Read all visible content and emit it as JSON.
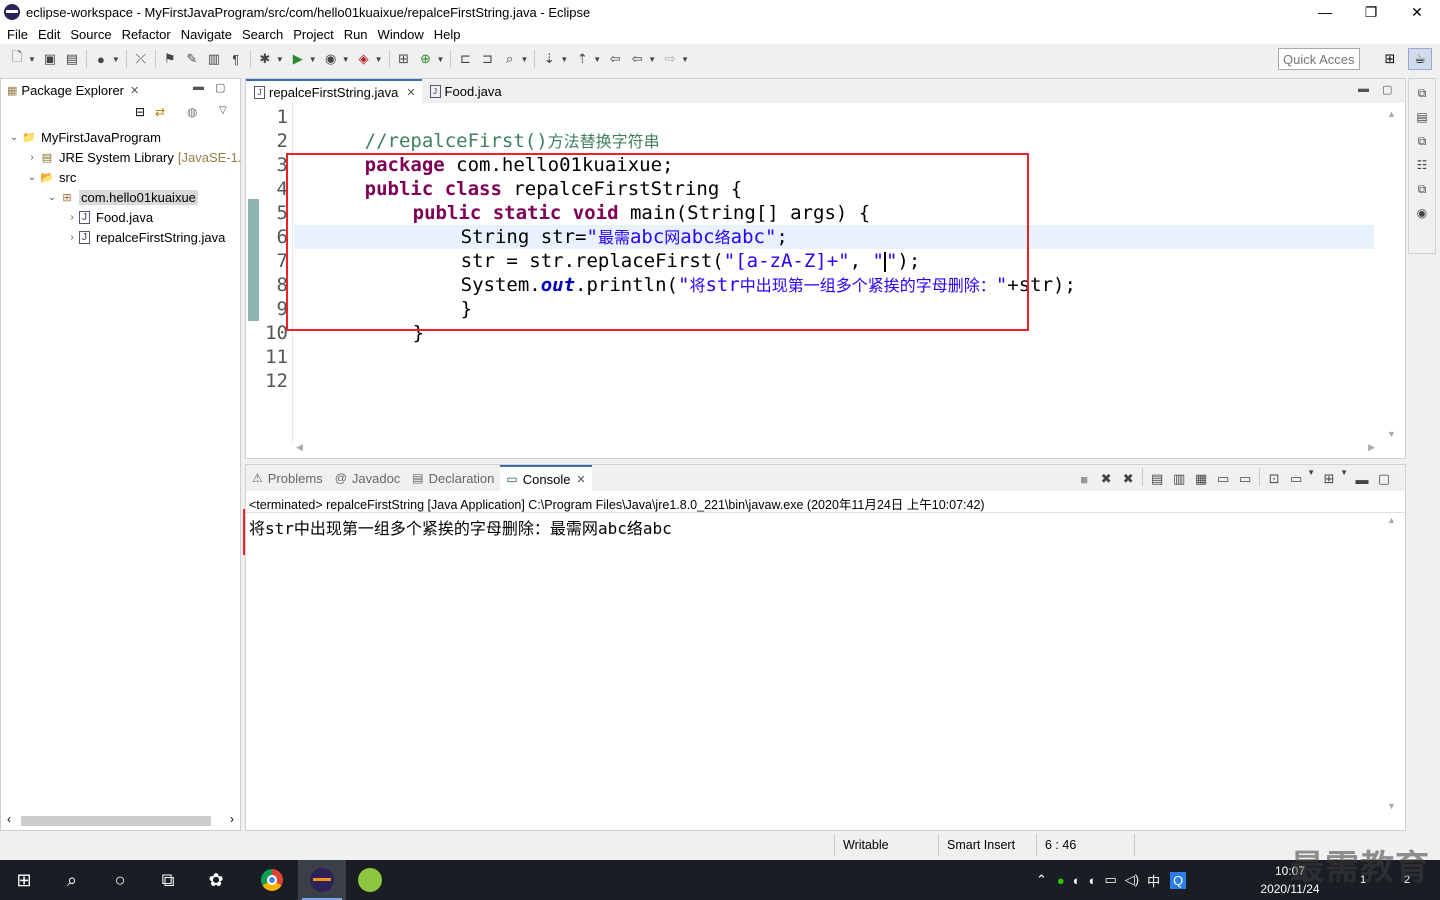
{
  "window": {
    "title": "eclipse-workspace - MyFirstJavaProgram/src/com/hello01kuaixue/repalceFirstString.java - Eclipse",
    "minimize": "—",
    "maximize": "❐",
    "close": "✕"
  },
  "menu": [
    "File",
    "Edit",
    "Source",
    "Refactor",
    "Navigate",
    "Search",
    "Project",
    "Run",
    "Window",
    "Help"
  ],
  "toolbar": {
    "quick_access_placeholder": "Quick Access"
  },
  "package_explorer": {
    "title": "Package Explorer",
    "tree": [
      {
        "label": "MyFirstJavaProgram",
        "decoration": "",
        "icon": "project-icon"
      },
      {
        "label": "JRE System Library",
        "decoration": "[JavaSE-1.",
        "icon": "library-icon"
      },
      {
        "label": "src",
        "decoration": "",
        "icon": "source-folder-icon"
      },
      {
        "label": "com.hello01kuaixue",
        "decoration": "",
        "icon": "package-icon"
      },
      {
        "label": "Food.java",
        "decoration": "",
        "icon": "java-file-icon"
      },
      {
        "label": "repalceFirstString.java",
        "decoration": "",
        "icon": "java-file-icon"
      }
    ]
  },
  "editor": {
    "tabs": [
      {
        "label": "repalceFirstString.java",
        "active": true
      },
      {
        "label": "Food.java",
        "active": false
      }
    ],
    "line_numbers": [
      "1",
      "2",
      "3",
      "4",
      "5",
      "6",
      "7",
      "8",
      "9",
      "10",
      "11",
      "12"
    ],
    "code": {
      "l1_comment": "//repalceFirst()",
      "l1_comment_cjk": "方法替换字符串",
      "l2_kw": "package",
      "l2_rest": " com.hello01kuaixue;",
      "l3_kw": "public class",
      "l3_rest": " repalceFirstString {",
      "l4_kw": "public static void",
      "l4_rest": " main(String[] args) {",
      "l5_pre": "String str=",
      "l5_str_q": "\"",
      "l5_str_c1": "最需",
      "l5_str_a1": "abc",
      "l5_str_c2": "网",
      "l5_str_a2": "abc",
      "l5_str_c3": "络",
      "l5_str_a3": "abc\"",
      "l5_end": ";",
      "l6_pre": "str = str.replaceFirst(",
      "l6_str1": "\"[a-zA-Z]+\"",
      "l6_mid": ", ",
      "l6_str2a": "\"",
      "l6_str2b": "\"",
      "l6_end": ");",
      "l7_pre": "System.",
      "l7_field": "out",
      "l7_mid": ".println(",
      "l7_str_q": "\"",
      "l7_str_c1": "将",
      "l7_str_a1": "str",
      "l7_str_c2": "中出现第一组多个紧挨的字母删除：",
      "l7_str_end": "\"",
      "l7_end": "+str);",
      "l8": "}",
      "l9": "}"
    }
  },
  "console_view": {
    "tabs": [
      {
        "label": "Problems",
        "icon": "problems-icon",
        "active": false
      },
      {
        "label": "Javadoc",
        "icon": "javadoc-icon",
        "active": false
      },
      {
        "label": "Declaration",
        "icon": "declaration-icon",
        "active": false
      },
      {
        "label": "Console",
        "icon": "console-icon",
        "active": true
      }
    ],
    "terminated": "<terminated> repalceFirstString [Java Application] C:\\Program Files\\Java\\jre1.8.0_221\\bin\\javaw.exe (2020年11月24日 上午10:07:42)",
    "output_c1": "将",
    "output_a1": "str",
    "output_c2": "中出现第一组多个紧挨的字母删除：最需网",
    "output_a2": "abc",
    "output_c3": "络",
    "output_a3": "abc"
  },
  "statusbar": {
    "writable": "Writable",
    "insert_mode": "Smart Insert",
    "position": "6 : 46"
  },
  "taskbar": {
    "time": "10:07",
    "date": "2020/11/24",
    "ime": "中",
    "badge_1": "1",
    "badge_2": "2"
  },
  "watermark": "最需教育",
  "colors": {
    "keyword": "#7f0055",
    "string": "#2a00ff",
    "comment": "#3f7f5f",
    "highlight_box": "#e3242b",
    "current_line": "#e8f2fe"
  }
}
